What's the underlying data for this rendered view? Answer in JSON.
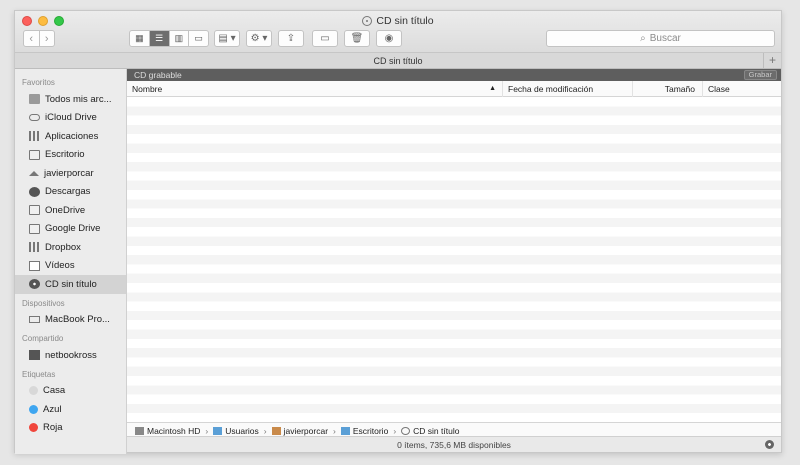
{
  "window": {
    "title": "CD sin título"
  },
  "toolbar": {
    "back_icon": "chevron-left-icon",
    "forward_icon": "chevron-right-icon",
    "view_icons": [
      "icon-view",
      "list-view",
      "column-view",
      "coverflow-view"
    ],
    "arrange_label": "▤ ▾",
    "action_label": "⚙ ▾",
    "search_placeholder": "Buscar"
  },
  "tab": {
    "label": "CD sin título"
  },
  "sidebar": {
    "sections": [
      {
        "title": "Favoritos",
        "items": [
          {
            "label": "Todos mis arc...",
            "icon": "all-files-icon"
          },
          {
            "label": "iCloud Drive",
            "icon": "cloud-icon"
          },
          {
            "label": "Aplicaciones",
            "icon": "applications-icon"
          },
          {
            "label": "Escritorio",
            "icon": "desktop-icon"
          },
          {
            "label": "javierporcar",
            "icon": "home-icon"
          },
          {
            "label": "Descargas",
            "icon": "downloads-icon"
          },
          {
            "label": "OneDrive",
            "icon": "folder-icon"
          },
          {
            "label": "Google Drive",
            "icon": "folder-icon"
          },
          {
            "label": "Dropbox",
            "icon": "dropbox-icon"
          },
          {
            "label": "Vídeos",
            "icon": "film-icon"
          },
          {
            "label": "CD sin título",
            "icon": "cd-icon",
            "selected": true
          }
        ]
      },
      {
        "title": "Dispositivos",
        "items": [
          {
            "label": "MacBook Pro...",
            "icon": "laptop-icon"
          }
        ]
      },
      {
        "title": "Compartido",
        "items": [
          {
            "label": "netbookross",
            "icon": "monitor-icon"
          }
        ]
      },
      {
        "title": "Etiquetas",
        "items": [
          {
            "label": "Casa",
            "icon": "tag-dot-icon",
            "color": "#d8d8d8"
          },
          {
            "label": "Azul",
            "icon": "tag-dot-icon",
            "color": "#3fa6f0"
          },
          {
            "label": "Roja",
            "icon": "tag-dot-icon",
            "color": "#f0463c"
          }
        ]
      }
    ]
  },
  "content": {
    "cd_bar_label": "CD grabable",
    "burn_button": "Grabar",
    "columns": [
      "Nombre",
      "Fecha de modificación",
      "Tamaño",
      "Clase"
    ]
  },
  "pathbar": {
    "items": [
      "Macintosh HD",
      "Usuarios",
      "javierporcar",
      "Escritorio",
      "CD sin título"
    ]
  },
  "statusbar": {
    "text": "0 ítems, 735,6 MB disponibles"
  },
  "colors": {
    "close": "#fc605c",
    "minimize": "#fdbc40",
    "maximize": "#34c84a",
    "selection": "#d3d3d3"
  }
}
